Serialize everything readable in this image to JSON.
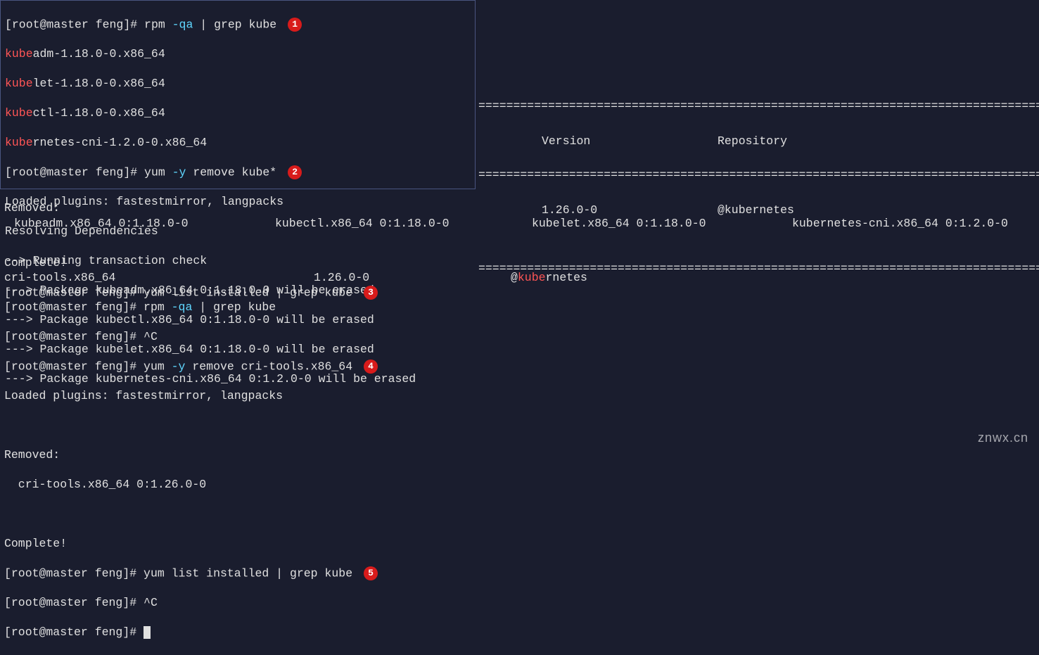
{
  "badges": {
    "b1": "1",
    "b2": "2",
    "b3": "3",
    "b4": "4",
    "b5": "5"
  },
  "box1": {
    "line1_prompt": "[root@master feng]# ",
    "line1_cmd": "rpm ",
    "line1_opt": "-qa",
    "line1_rest": " | grep kube",
    "line2_hl": "kube",
    "line2_rest": "adm-1.18.0-0.x86_64",
    "line3_hl": "kube",
    "line3_rest": "let-1.18.0-0.x86_64",
    "line4_hl": "kube",
    "line4_rest": "ctl-1.18.0-0.x86_64",
    "line5_hl": "kube",
    "line5_rest": "rnetes-cni-1.2.0-0.x86_64",
    "line6_prompt": "[root@master feng]# ",
    "line6_cmd": "yum ",
    "line6_opt": "-y",
    "line6_rest": " remove kube*",
    "line7": "Loaded plugins: fastestmirror, langpacks",
    "line8": "Resolving Dependencies",
    "line9": "--> Running transaction check",
    "line10": "---> Package kubeadm.x86_64 0:1.18.0-0 will be erased",
    "line11": "---> Package kubectl.x86_64 0:1.18.0-0 will be erased",
    "line12": "---> Package kubelet.x86_64 0:1.18.0-0 will be erased",
    "line13": "---> Package kubernetes-cni.x86_64 0:1.2.0-0 will be erased"
  },
  "right": {
    "hdr_version": "Version",
    "hdr_repo": "Repository",
    "row_version": "1.26.0-0",
    "row_repo": "@kubernetes"
  },
  "removed": {
    "label": "Removed:",
    "c1": "kubeadm.x86_64 0:1.18.0-0",
    "c2": "kubectl.x86_64 0:1.18.0-0",
    "c3": "kubelet.x86_64 0:1.18.0-0",
    "c4": "kubernetes-cni.x86_64 0:1.2.0-0"
  },
  "lower": {
    "complete1": "Complete!",
    "l1_prompt": "[root@master feng]# ",
    "l1_cmd": "yum list installed | grep kube",
    "l2_c1": "cri-tools.x86_64",
    "l2_c2": "1.26.0-0",
    "l2_c3_at": "@",
    "l2_c3_hl": "kube",
    "l2_c3_rest": "rnetes",
    "l3_prompt": "[root@master feng]# ",
    "l3_cmd": "rpm ",
    "l3_opt": "-qa",
    "l3_rest": " | grep kube",
    "l4_prompt": "[root@master feng]# ",
    "l4_cmd": "^C",
    "l5_prompt": "[root@master feng]# ",
    "l5_cmd": "yum ",
    "l5_opt": "-y",
    "l5_rest": " remove cri-tools.x86_64",
    "l6": "Loaded plugins: fastestmirror, langpacks",
    "removed2": "Removed:",
    "l7": "  cri-tools.x86_64 0:1.26.0-0",
    "complete2": "Complete!",
    "l8_prompt": "[root@master feng]# ",
    "l8_cmd": "yum list installed | grep kube",
    "l9_prompt": "[root@master feng]# ",
    "l9_cmd": "^C",
    "l10_prompt": "[root@master feng]# "
  },
  "watermark": "znwx.cn",
  "dline": "================================================================================="
}
